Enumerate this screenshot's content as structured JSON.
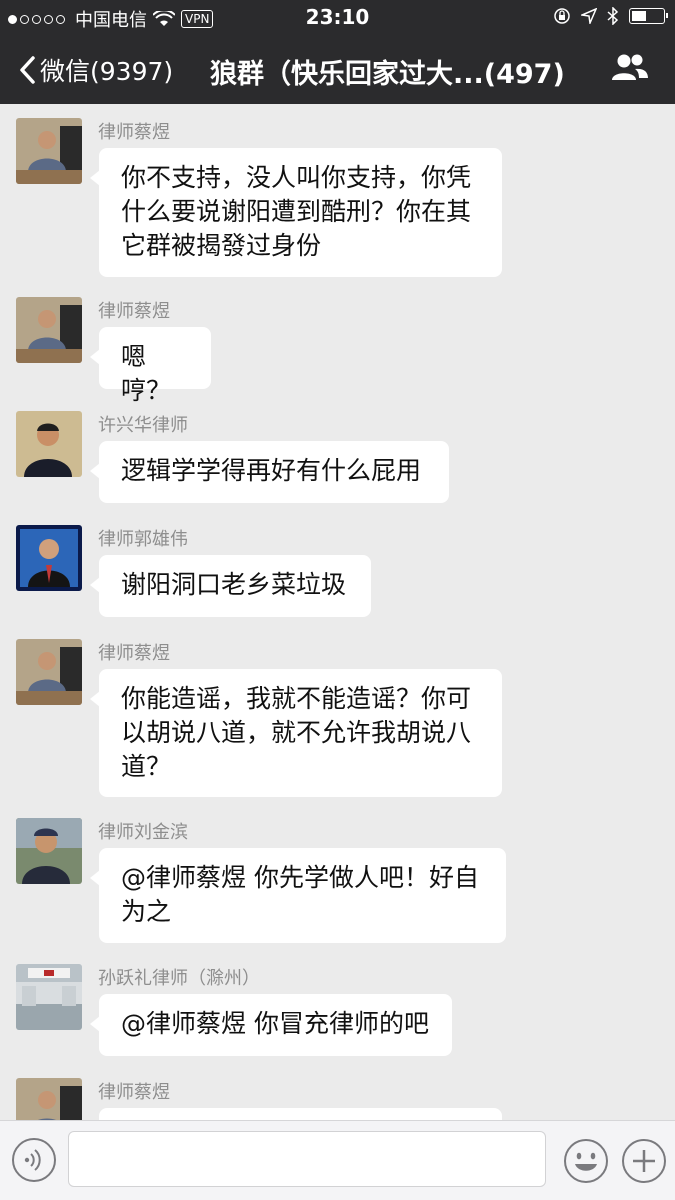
{
  "status": {
    "carrier": "中国电信",
    "vpn": "VPN",
    "time": "23:10"
  },
  "nav": {
    "back_label": "微信(9397)",
    "title": "狼群（快乐回家过大...(497)"
  },
  "messages": [
    {
      "sender": "律师蔡煜",
      "lines": [
        "你不支持，没人叫你支持，你凭",
        "什么要说谢阳遭到酷刑？你在其",
        "它群被揭發过身份"
      ]
    },
    {
      "sender": "律师蔡煜",
      "lines": [
        "嗯哼？"
      ]
    },
    {
      "sender": "许兴华律师",
      "lines": [
        "逻辑学学得再好有什么屁用"
      ]
    },
    {
      "sender": "律师郭雄伟",
      "lines": [
        "谢阳洞口老乡菜垃圾"
      ]
    },
    {
      "sender": "律师蔡煜",
      "lines": [
        "你能造谣，我就不能造谣？你可",
        "以胡说八道，就不允许我胡说八",
        "道？"
      ]
    },
    {
      "sender": "律师刘金滨",
      "lines": [
        "@律师蔡煜 你先学做人吧！好自",
        "为之"
      ]
    },
    {
      "sender": "孙跃礼律师（滁州）",
      "lines": [
        "@律师蔡煜 你冒充律师的吧"
      ]
    },
    {
      "sender": "律师蔡煜",
      "lines": [
        ""
      ]
    }
  ]
}
